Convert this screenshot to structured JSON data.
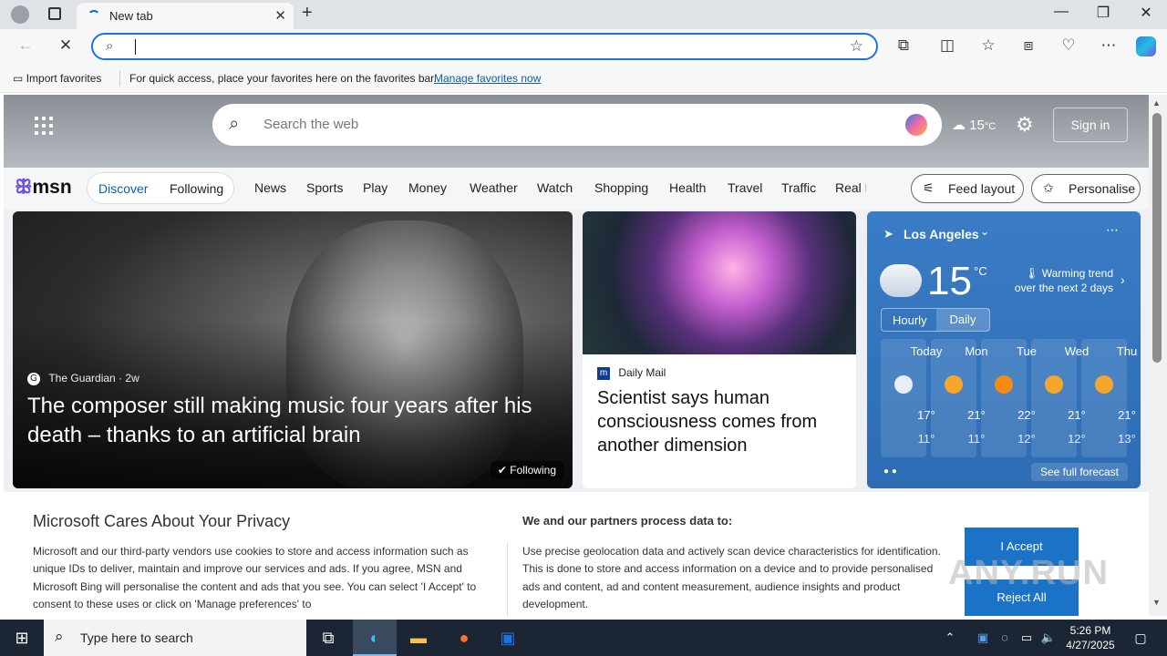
{
  "browser": {
    "tab_title": "New tab",
    "address_value": "",
    "favorites_bar": {
      "import": "Import favorites",
      "message": "For quick access, place your favorites here on the favorites bar.",
      "manage_link": "Manage favorites now"
    }
  },
  "msn": {
    "search_placeholder": "Search the web",
    "top_weather": "15",
    "top_weather_unit": "°C",
    "sign_in": "Sign in",
    "logo": "msn",
    "discover": "Discover",
    "following": "Following",
    "nav": [
      "News",
      "Sports",
      "Play",
      "Money",
      "Weather",
      "Watch",
      "Shopping",
      "Health",
      "Travel",
      "Traffic",
      "Real E"
    ],
    "feed_layout": "Feed layout",
    "personalise": "Personalise"
  },
  "cards": {
    "big": {
      "source": "The Guardian",
      "age": "2w",
      "headline": "The composer still making music four years after his death – thanks to an artificial brain",
      "following": "Following"
    },
    "mid": {
      "source": "Daily Mail",
      "headline": "Scientist says human consciousness comes from another dimension"
    }
  },
  "weather": {
    "location": "Los Angeles",
    "temp": "15",
    "unit": "°C",
    "trend_line1": "Warming trend",
    "trend_line2": "over the next 2 days",
    "tab_hourly": "Hourly",
    "tab_daily": "Daily",
    "days": [
      {
        "name": "Today",
        "hi": "17°",
        "lo": "11°"
      },
      {
        "name": "Mon",
        "hi": "21°",
        "lo": "11°"
      },
      {
        "name": "Tue",
        "hi": "22°",
        "lo": "12°"
      },
      {
        "name": "Wed",
        "hi": "21°",
        "lo": "12°"
      },
      {
        "name": "Thu",
        "hi": "21°",
        "lo": "13°"
      }
    ],
    "see_full": "See full forecast"
  },
  "privacy": {
    "title": "Microsoft Cares About Your Privacy",
    "body": "Microsoft and our third-party vendors use cookies to store and access information such as unique IDs to deliver, maintain and improve our services and ads. If you agree, MSN and Microsoft Bing will personalise the content and ads that you see. You can select 'I Accept' to consent to these uses or click on 'Manage preferences' to",
    "partners_title": "We and our partners process data to:",
    "partners_body": "Use precise geolocation data and actively scan device characteristics for identification. This is done to store and access information on a device and to provide personalised ads and content, ad and content measurement, audience insights and product development.",
    "accept": "I Accept",
    "reject": "Reject All",
    "watermark": "ANY.RUN"
  },
  "taskbar": {
    "search_text": "Type here to search",
    "time": "5:26 PM",
    "date": "4/27/2025"
  }
}
